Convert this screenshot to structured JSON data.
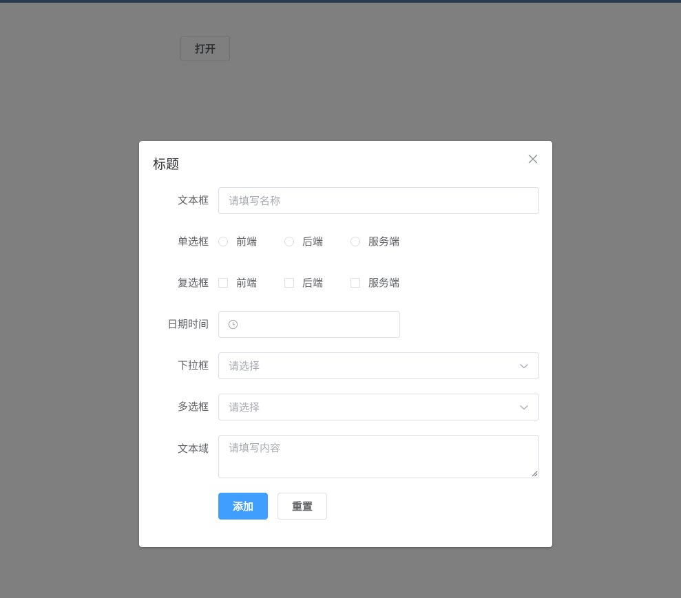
{
  "page": {
    "open_button_label": "打开"
  },
  "dialog": {
    "title": "标题"
  },
  "form": {
    "text_input": {
      "label": "文本框",
      "placeholder": "请填写名称"
    },
    "radio": {
      "label": "单选框",
      "options": [
        "前端",
        "后端",
        "服务端"
      ]
    },
    "checkbox": {
      "label": "复选框",
      "options": [
        "前端",
        "后端",
        "服务端"
      ]
    },
    "datetime": {
      "label": "日期时间"
    },
    "select": {
      "label": "下拉框",
      "placeholder": "请选择"
    },
    "multi_select": {
      "label": "多选框",
      "placeholder": "请选择"
    },
    "textarea": {
      "label": "文本域",
      "placeholder": "请填写内容"
    },
    "buttons": {
      "add_label": "添加",
      "reset_label": "重置"
    }
  },
  "colors": {
    "primary": "#409eff",
    "border": "#dcdfe6",
    "placeholder": "#a8abb2",
    "label": "#606266",
    "title": "#303133",
    "overlay": "rgba(0,0,0,0.5)"
  },
  "icons": {
    "close": "close-icon",
    "clock": "clock-icon",
    "select_arrow": "chevron-down-icon"
  }
}
